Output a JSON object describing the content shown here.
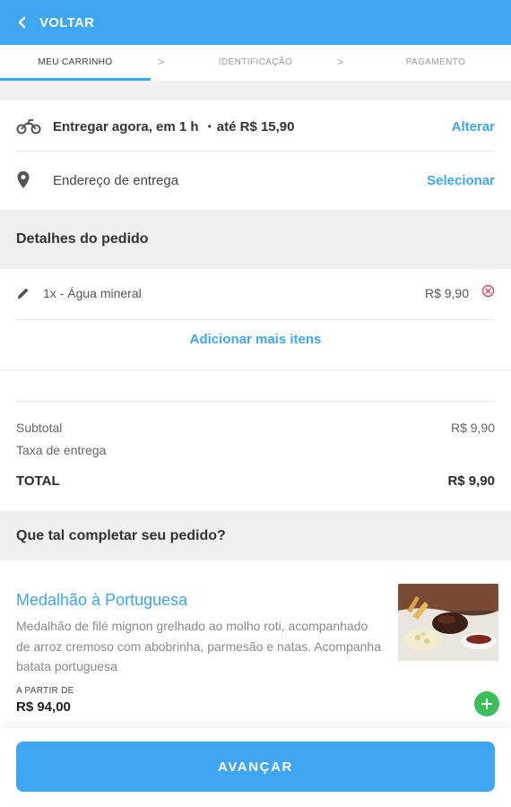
{
  "header": {
    "back_label": "VOLTAR"
  },
  "steps": [
    {
      "label": "MEU CARRINHO",
      "active": true
    },
    {
      "label": "IDENTIFICAÇÃO",
      "active": false
    },
    {
      "label": "PAGAMENTO",
      "active": false
    }
  ],
  "step_separator": ">",
  "delivery": {
    "time_text": "Entregar agora, em 1 h",
    "bullet": "•",
    "price_text": "até R$ 15,90",
    "change_link": "Alterar",
    "icon": "motorcycle-icon"
  },
  "address": {
    "label": "Endereço de entrega",
    "select_link": "Selecionar",
    "icon": "location-pin-icon"
  },
  "order_details": {
    "title": "Detalhes do pedido",
    "items": [
      {
        "qty_name": "1x - Água mineral",
        "price": "R$ 9,90"
      }
    ],
    "add_more": "Adicionar mais itens"
  },
  "summary": {
    "subtotal_label": "Subtotal",
    "subtotal_value": "R$ 9,90",
    "delivery_fee_label": "Taxa de entrega",
    "total_label": "TOTAL",
    "total_value": "R$ 9,90"
  },
  "suggestions": {
    "title": "Que tal completar seu pedido?",
    "product": {
      "name": "Medalhão à Portuguesa",
      "description": "Medalhão de filé mignon grelhado ao molho roti, acompanhado de arroz cremoso com abobrinha, parmesão e natas. Acompanha batata portuguesa",
      "from_label": "A PARTIR DE",
      "price": "R$ 94,00"
    }
  },
  "cta": {
    "label": "AVANÇAR"
  },
  "colors": {
    "accent": "#3fa6f2",
    "remove": "#e0465a",
    "add": "#3cbf5a"
  }
}
